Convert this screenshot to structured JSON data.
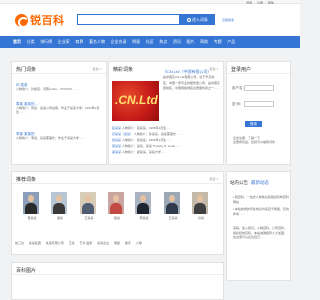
{
  "topbar": {
    "links": [
      "登录",
      "注册",
      "帮助"
    ]
  },
  "header": {
    "logo_text": "锐百科",
    "search_placeholder": "",
    "search_button": "进入词条",
    "search_button2": "搜索词条",
    "advanced": "高级搜索"
  },
  "nav": {
    "items": [
      "首页",
      "分类",
      "排行榜",
      "企业家",
      "商界",
      "著名人物",
      "企业名录",
      "明星",
      "社区",
      "热点",
      "资讯",
      "图片",
      "帮助",
      "专题",
      "产品"
    ]
  },
  "hot": {
    "title": "热门词条",
    "more": "更多>>",
    "items": [
      {
        "name": "孙 俊英",
        "desc": "人物简介：孙俊英，河南Linkin，XXXXXX……"
      },
      {
        "name": "周某 某某的…",
        "desc": "人物简介：周某，某某公司总裁，毕业于某某大学，1964年2月生……"
      },
      {
        "name": "李某 某某的",
        "desc": "人物简介：李某，某某董事长，毕业于某某大学……"
      }
    ]
  },
  "featured": {
    "title": "精彩词条",
    "more": "更多>>",
    "company": "《CN.Ltd（中国有限公司）",
    "logo_text": ".CN.Ltd",
    "desc": "是中国东CN.Ltd有限公司，位于华东地区，中国一家专业的服务型公司，是中国东部地区，中国网络域名注册服务商之一……",
    "lines": [
      {
        "name": "赵某某",
        "text": "人物简介：赵某某，1966年1月生……"
      },
      {
        "name": "孙某某（某某）",
        "text": "人物简介：孙某某，某某董事长……"
      },
      {
        "name": "钱某某",
        "text": "人物简介：钱某某，1969年1月生……"
      },
      {
        "name": "吴某某",
        "text": "人物简介：某某，某某 Timothy D. Cook……"
      },
      {
        "name": "郑某某",
        "text": "人物简介：郑某某，某某大学……"
      }
    ]
  },
  "login": {
    "title": "登录用户",
    "username_label": "用户名：",
    "password_label": "密 码：",
    "submit": "登录",
    "links": [
      "没有帐号，请注册",
      "忘记密码？找回密码"
    ],
    "register_hint": "点击注册，了解一下",
    "register_hint2": "注册成功后，您就可以编辑词条"
  },
  "recommended": {
    "title": "推荐词条",
    "more": "更多>>",
    "people": [
      "曹某某",
      "潘某",
      "王某某",
      "陆某",
      "李某某",
      "王某某",
      "孙某"
    ],
    "tags": [
      "前三位",
      "某某集团",
      "某某有限公司",
      "王某",
      "艺术 画家",
      "某某企业",
      "明星",
      "歌手",
      "人物"
    ]
  },
  "notice": {
    "tabs": [
      "站内公告",
      "最新动态"
    ],
    "items": [
      "锐百科，一站式人物信息和组织机构百科网站",
      "本站收录的词条信息均来自于网络，仅供参考……",
      "如有侵权，请联系我们"
    ],
    "ad": "来稿，加入我们。人物百科，公司百科，组织机构百科，本站诚邀各界人士加盟，在这里可以表达自己……"
  },
  "images": {
    "title": "百科图片"
  }
}
